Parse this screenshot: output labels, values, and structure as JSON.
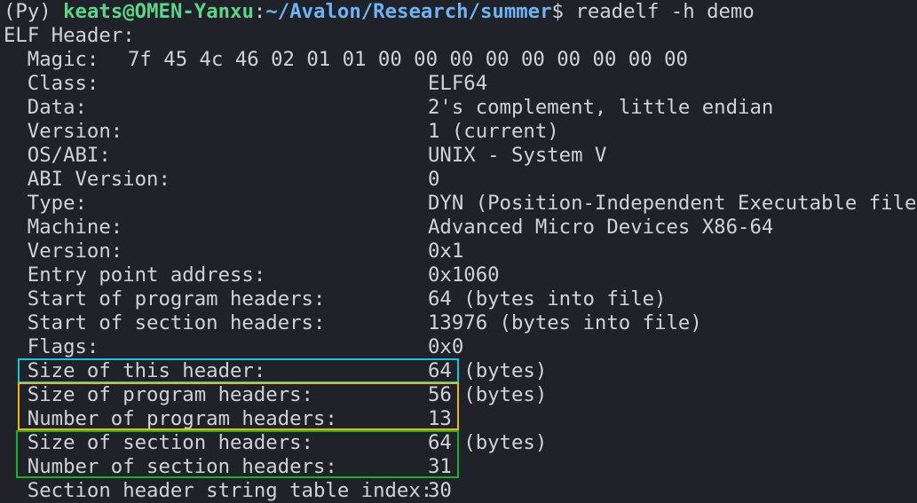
{
  "prompt": {
    "env": "(Py) ",
    "user_host": "keats@OMEN-Yanxu",
    "colon": ":",
    "path": "~/Avalon/Research/summer",
    "dollar": "$ ",
    "command": "readelf -h demo"
  },
  "heading": "ELF Header:",
  "rows": [
    {
      "label": "Magic:",
      "value": "7f 45 4c 46 02 01 01 00 00 00 00 00 00 00 00 00"
    },
    {
      "label": "Class:",
      "value": "ELF64"
    },
    {
      "label": "Data:",
      "value": "2's complement, little endian"
    },
    {
      "label": "Version:",
      "value": "1 (current)"
    },
    {
      "label": "OS/ABI:",
      "value": "UNIX - System V"
    },
    {
      "label": "ABI Version:",
      "value": "0"
    },
    {
      "label": "Type:",
      "value": "DYN (Position-Independent Executable file)"
    },
    {
      "label": "Machine:",
      "value": "Advanced Micro Devices X86-64"
    },
    {
      "label": "Version:",
      "value": "0x1"
    },
    {
      "label": "Entry point address:",
      "value": "0x1060"
    },
    {
      "label": "Start of program headers:",
      "value": "64 (bytes into file)"
    },
    {
      "label": "Start of section headers:",
      "value": "13976 (bytes into file)"
    },
    {
      "label": "Flags:",
      "value": "0x0"
    },
    {
      "label": "Size of this header:",
      "value": "64 (bytes)"
    },
    {
      "label": "Size of program headers:",
      "value": "56 (bytes)"
    },
    {
      "label": "Number of program headers:",
      "value": "13"
    },
    {
      "label": "Size of section headers:",
      "value": "64 (bytes)"
    },
    {
      "label": "Number of section headers:",
      "value": "31"
    },
    {
      "label": "Section header string table index:",
      "value": "30"
    }
  ],
  "highlight_colors": {
    "this_header": "#18c6dc",
    "program_headers": "#f2b50c",
    "section_headers": "#1fae2a"
  }
}
